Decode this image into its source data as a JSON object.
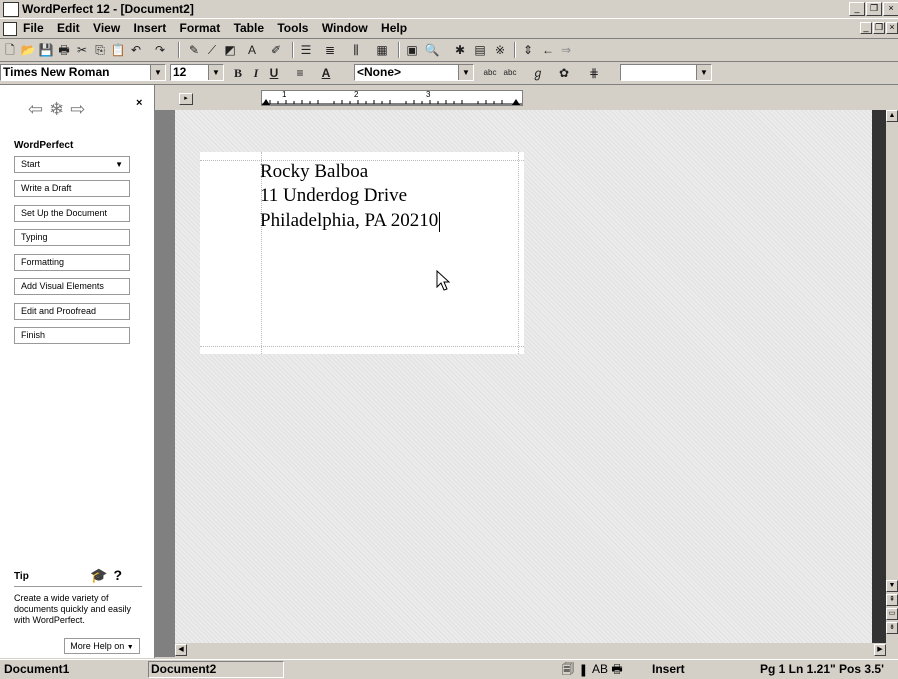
{
  "window": {
    "title": "WordPerfect 12 - [Document2]"
  },
  "menu": [
    "File",
    "Edit",
    "View",
    "Insert",
    "Format",
    "Table",
    "Tools",
    "Window",
    "Help"
  ],
  "property_bar": {
    "font_name": "Times New Roman",
    "font_size": "12",
    "style": "<None>"
  },
  "sidebar": {
    "heading": "WordPerfect",
    "start_label": "Start",
    "steps": [
      "Write a Draft",
      "Set Up the Document",
      "Typing",
      "Formatting",
      "Add Visual Elements",
      "Edit and Proofread",
      "Finish"
    ],
    "tip_label": "Tip",
    "tip_text": "Create a wide variety of documents quickly and easily with WordPerfect.",
    "more_help": "More Help on"
  },
  "ruler": {
    "numbers": [
      "1",
      "2",
      "3"
    ]
  },
  "document": {
    "lines": [
      "Rocky Balboa",
      "11 Underdog Drive",
      "Philadelphia, PA 20210"
    ]
  },
  "status": {
    "doc1": "Document1",
    "doc2": "Document2",
    "mode": "Insert",
    "position": "Pg 1 Ln 1.21\" Pos 3.5'"
  }
}
